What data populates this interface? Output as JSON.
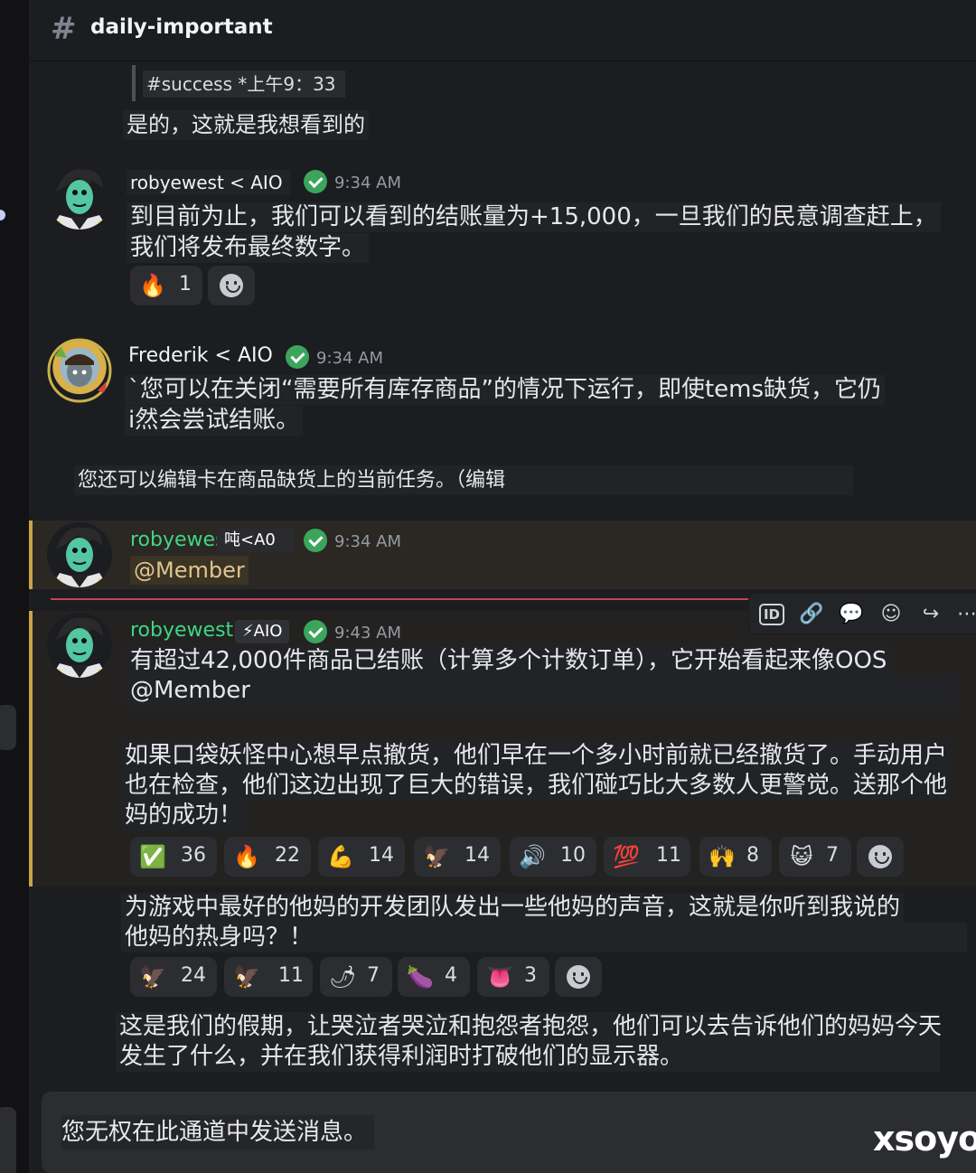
{
  "channel": {
    "name": "daily-important"
  },
  "messages": {
    "m0": {
      "reply_snippet": "#success *上午9：33",
      "text": "是的，这就是我想看到的"
    },
    "m1": {
      "author": "robyewest < AIO",
      "time": "9:34 AM",
      "line1": "到目前为止，我们可以看到的结账量为+15,000，一旦我们的民意调查赶上，",
      "line2": "我们将发布最终数字。",
      "reactions": [
        {
          "emoji": "🔥",
          "count": "1"
        }
      ]
    },
    "m2": {
      "author": "Frederik < AIO",
      "time": "9:34 AM",
      "line1": "`您可以在关闭“需要所有库存商品”的情况下运行，即使tems缺货，它仍",
      "line2": "i然会尝试结账。",
      "line3": "您还可以编辑卡在商品缺货上的当前任务。（编辑"
    },
    "m3": {
      "author": "robyewes",
      "author_suffix": "吨<A0",
      "time": "9:34 AM",
      "mention": "@Member"
    },
    "m4": {
      "author": "robyewest",
      "tag": "⚡AIO",
      "time": "9:43 AM",
      "line1": "有超过42,000件商品已结账（计算多个计数订单），它开始看起来像OOS",
      "line2": "@Member",
      "p2_line1": "如果口袋妖怪中心想早点撤货，他们早在一个多小时前就已经撤货了。手动用户",
      "p2_line2": "也在检查，他们这边出现了巨大的错误，我们碰巧比大多数人更警觉。送那个他",
      "p2_line3": "妈的成功！",
      "reactions": [
        {
          "emoji": "✅",
          "count": "36"
        },
        {
          "emoji": "🔥",
          "count": "22"
        },
        {
          "emoji": "💪",
          "count": "14"
        },
        {
          "emoji": "🦅",
          "count": "14"
        },
        {
          "emoji": "🔊",
          "count": "10"
        },
        {
          "emoji": "💯",
          "count": "11"
        },
        {
          "emoji": "🙌",
          "count": "8"
        },
        {
          "emoji": "😺",
          "count": "7"
        }
      ],
      "p3_line1": "为游戏中最好的他妈的开发团队发出一些他妈的声音，这就是你听到我说的",
      "p3_line2": "他妈的热身吗？！",
      "reactions2": [
        {
          "emoji": "🦅",
          "count": "24"
        },
        {
          "emoji": "🦅",
          "count": "11"
        },
        {
          "emoji": "🌶",
          "count": "7"
        },
        {
          "emoji": "🍆",
          "count": "4"
        },
        {
          "emoji": "👅",
          "count": "3"
        }
      ],
      "p4_line1": "这是我们的假期，让哭泣者哭泣和抱怨者抱怨，他们可以去告诉他们的妈妈今天",
      "p4_line2": "发生了什么，并在我们获得利润时打破他们的显示器。"
    }
  },
  "toolbar": {
    "icons": [
      "id-icon",
      "link-icon",
      "thread-icon",
      "add-reaction-icon",
      "forward-icon",
      "more-icon"
    ],
    "id_label": "ID"
  },
  "composer": {
    "placeholder": "您无权在此通道中发送消息。"
  },
  "watermark": "xsoyo",
  "colors": {
    "accent_green": "#3ed684",
    "highlight_bar": "#c9a34a",
    "new_divider": "#c4464a",
    "verified": "#3ba55c"
  }
}
